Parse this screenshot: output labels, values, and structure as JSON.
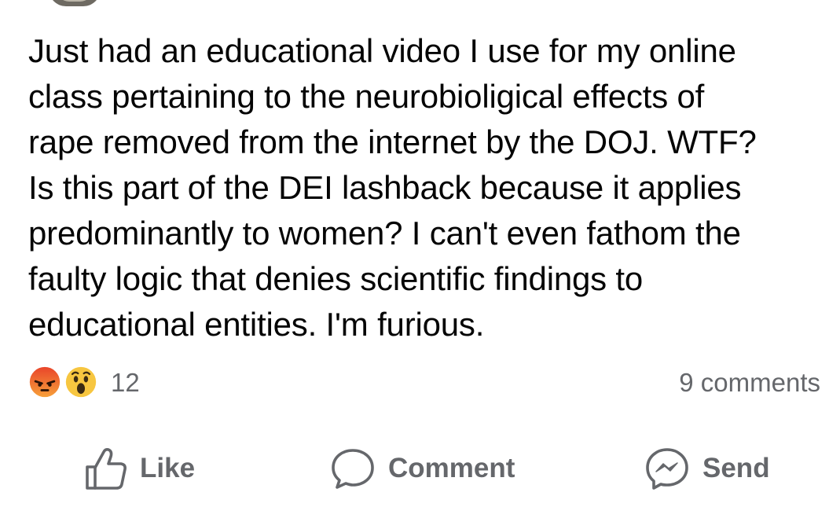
{
  "post": {
    "text": "Just had an educational video I use for my online\nclass pertaining to the neurobioligical effects of\nrape removed from the internet by the DOJ.  WTF?\nIs this part of the DEI lashback because it applies\npredominantly to women?  I can't even fathom the\nfaulty logic that denies scientific findings to\neducational entities.  I'm furious."
  },
  "reactions": {
    "icons": [
      "angry-reaction-icon",
      "wow-reaction-icon"
    ],
    "count": "12",
    "comments": "9 comments"
  },
  "actions": {
    "like_label": "Like",
    "comment_label": "Comment",
    "send_label": "Send"
  },
  "colors": {
    "text": "#050505",
    "muted": "#65676b",
    "angry": "#f0702a",
    "wow": "#f7b928"
  }
}
